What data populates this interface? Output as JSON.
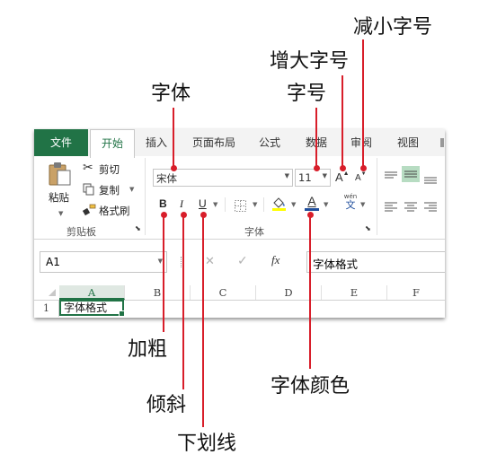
{
  "callouts": {
    "font": "字体",
    "font_size": "字号",
    "grow_font": "增大字号",
    "shrink_font": "减小字号",
    "bold": "加粗",
    "italic": "倾斜",
    "underline": "下划线",
    "font_color": "字体颜色"
  },
  "tabs": [
    "文件",
    "开始",
    "插入",
    "页面布局",
    "公式",
    "数据",
    "审阅",
    "视图"
  ],
  "clipboard": {
    "paste": "粘贴",
    "cut": "剪切",
    "copy": "复制",
    "format_painter": "格式刷",
    "group_label": "剪贴板"
  },
  "font_group": {
    "font_name": "宋体",
    "font_size": "11",
    "grow": "A",
    "shrink": "A",
    "bold": "B",
    "italic": "I",
    "underline": "U",
    "font_color_glyph": "A",
    "phonetic_top": "wén",
    "phonetic_bottom": "文",
    "group_label": "字体"
  },
  "formula_bar": {
    "name_box": "A1",
    "cancel": "✕",
    "enter": "✓",
    "fx": "fx",
    "content": "字体格式"
  },
  "sheet": {
    "columns": [
      "A",
      "B",
      "C",
      "D",
      "E",
      "F"
    ],
    "row_numbers": [
      "1"
    ],
    "cell_a1": "字体格式"
  },
  "colors": {
    "accent": "#217346",
    "callout_line": "#d81e2a",
    "font_color_bar": "#1f4e9c",
    "fill_color_bar": "#ffff00"
  }
}
